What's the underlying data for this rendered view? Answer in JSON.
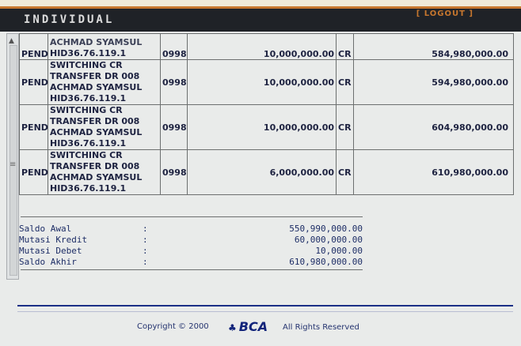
{
  "header": {
    "title": "INDIVIDUAL",
    "logout_label": "[ LOGOUT ]"
  },
  "transactions": [
    {
      "status": "PEND",
      "desc": [
        "ACHMAD SYAMSUL",
        "HID36.76.119.1"
      ],
      "branch": "0998",
      "amount": "10,000,000.00",
      "type": "CR",
      "balance": "584,980,000.00"
    },
    {
      "status": "PEND",
      "desc": [
        "SWITCHING CR",
        "TRANSFER DR 008",
        "ACHMAD SYAMSUL",
        "HID36.76.119.1"
      ],
      "branch": "0998",
      "amount": "10,000,000.00",
      "type": "CR",
      "balance": "594,980,000.00"
    },
    {
      "status": "PEND",
      "desc": [
        "SWITCHING CR",
        "TRANSFER DR 008",
        "ACHMAD SYAMSUL",
        "HID36.76.119.1"
      ],
      "branch": "0998",
      "amount": "10,000,000.00",
      "type": "CR",
      "balance": "604,980,000.00"
    },
    {
      "status": "PEND",
      "desc": [
        "SWITCHING CR",
        "TRANSFER DR 008",
        "ACHMAD SYAMSUL",
        "HID36.76.119.1"
      ],
      "branch": "0998",
      "amount": "6,000,000.00",
      "type": "CR",
      "balance": "610,980,000.00"
    }
  ],
  "summary": [
    {
      "label": "Saldo Awal",
      "colon": ":",
      "value": "550,990,000.00"
    },
    {
      "label": "Mutasi Kredit",
      "colon": ":",
      "value": "60,000,000.00"
    },
    {
      "label": "Mutasi Debet",
      "colon": ":",
      "value": "10,000.00"
    },
    {
      "label": "Saldo Akhir",
      "colon": ":",
      "value": "610,980,000.00"
    }
  ],
  "footer": {
    "copyright": "Copyright © 2000",
    "logo_text": "BCA",
    "rights": "All Rights Reserved"
  },
  "icons": {
    "scroll_up": "up-arrow-icon",
    "grip": "grip-icon",
    "bca_logo": "bca-logo-icon"
  },
  "colors": {
    "header_bg": "#1f2227",
    "accent": "#c6762e",
    "text": "#1d2240",
    "brand": "#12247a"
  }
}
